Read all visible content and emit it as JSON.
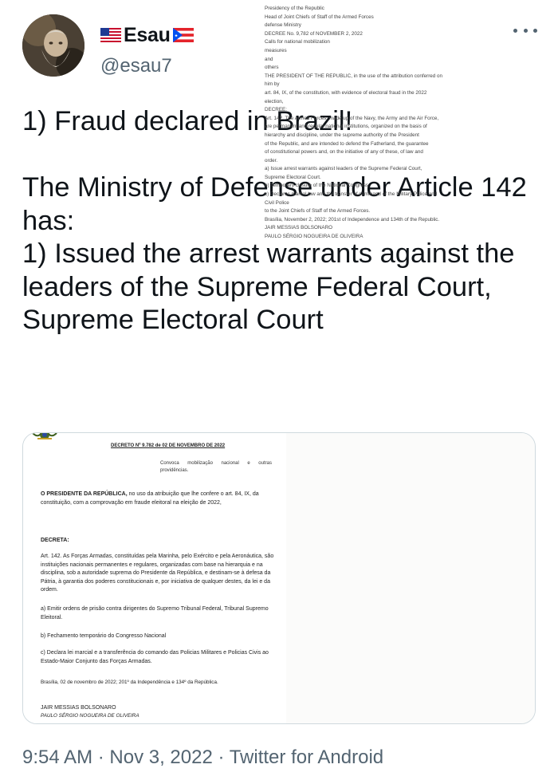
{
  "author": {
    "display_name": "Esau",
    "handle": "@esau7",
    "name_flags": [
      "us-flag-icon",
      "puerto-rico-flag-icon"
    ]
  },
  "tweet": {
    "text": "1) Fraud declared in Brazil!\n\nThe Ministry of Defense under Article 142 has:\n1) Issued the arrest warrants against the leaders of the Supreme Federal Court, Supreme Electoral Court"
  },
  "media": {
    "portuguese": {
      "title": "DECRETO Nº 9.782 de 02 DE NOVEMBRO DE 2022",
      "summary": "Convoca mobilização nacional e outras providências.",
      "preamble_bold": "O PRESIDENTE DA REPÚBLICA,",
      "preamble_rest": " no uso da atribuição que lhe confere o art. 84, IX, da constituição, com a comprovação em fraude eleitoral na eleição de 2022,",
      "decreta": "DECRETA:",
      "art142": "Art. 142. As Forças Armadas, constituídas pela Marinha, pelo Exército e pela Aeronáutica, são instituições nacionais permanentes e regulares, organizadas com base na hierarquia e na disciplina, sob a autoridade suprema do Presidente da República, e destinam-se à defesa da Pátria, à garantia dos poderes constitucionais e, por iniciativa de qualquer destes, da lei e da ordem.",
      "item_a": "a) Emitir ordens de prisão contra dirigentes do Supremo Tribunal Federal, Tribunal Supremo Eleitoral.",
      "item_b": "b) Fechamento temporário do Congresso Nacional",
      "item_c": "c) Declara lei marcial e a transferência do comando das Policias Militares e Policias Civis ao Estado-Maior Conjunto das Forças Armadas.",
      "date_line": "Brasília, 02 de novembro de 2022; 201º da Independência e 134º da República.",
      "signer1": "JAIR MESSIAS BOLSONARO",
      "signer2": "PAULO SÉRGIO NOGUEIRA DE OLIVEIRA"
    },
    "translation_lines": [
      "Presidency of the Republic",
      "Head of Joint Chiefs of Staff of the Armed Forces",
      "defense Ministry",
      "DECREE No. 9,782 of NOVEMBER 2, 2022",
      "Calls for national mobilization",
      "measures",
      "and",
      "others",
      "THE PRESIDENT OF THE REPUBLIC, in the use of the attribution conferred on",
      "him by",
      "art. 84, IX, of the constitution, with evidence of electoral fraud in the 2022",
      "election,",
      "DECREE:",
      "Art. 142. The Armed Forces, made up of the Navy, the Army and the Air Force,",
      "are permanent and regular national institutions, organized on the basis of",
      "hierarchy and discipline, under the supreme authority of the President",
      "of the Republic, and are intended to defend the Fatherland, the guarantee",
      "of constitutional powers and, on the initiative of any of these, of law and",
      "order.",
      "a) Issue arrest warrants against leaders of the Supreme Federal Court,",
      "Supreme Electoral Court.",
      "b) Temporary closure of the National Congress",
      "c) Declares martial law and the transfer of command of the Military Police and",
      "Civil Police",
      "to the Joint Chiefs of Staff of the Armed Forces.",
      "Brasília, November 2, 2022; 201st of Independence and 134th of the Republic.",
      "JAIR MESSIAS BOLSONARO",
      "PAULO SÉRGIO NOGUEIRA DE OLIVEIRA"
    ]
  },
  "meta": {
    "time": "9:54 AM",
    "separator": " · ",
    "date": "Nov 3, 2022",
    "client": "Twitter for Android"
  },
  "colors": {
    "text": "#0f1419",
    "secondary": "#536471",
    "border": "#cfd9de"
  }
}
